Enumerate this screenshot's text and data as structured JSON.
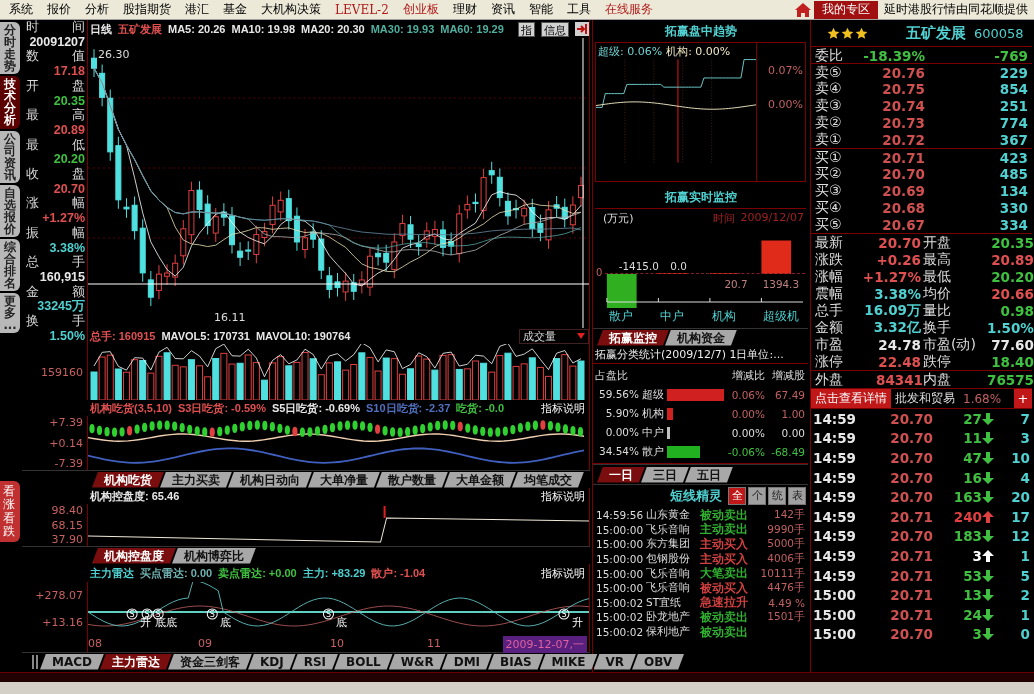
{
  "menu": [
    {
      "label": "系统",
      "highlight": false
    },
    {
      "label": "报价",
      "highlight": false
    },
    {
      "label": "分析",
      "highlight": false
    },
    {
      "label": "股指期货",
      "highlight": false
    },
    {
      "label": "港汇",
      "highlight": false
    },
    {
      "label": "基金",
      "highlight": false
    },
    {
      "label": "大机构决策",
      "highlight": false
    },
    {
      "label": "LEVEL-2",
      "highlight": true
    },
    {
      "label": "创业板",
      "highlight": true
    },
    {
      "label": "理财",
      "highlight": false
    },
    {
      "label": "资讯",
      "highlight": false
    },
    {
      "label": "智能",
      "highlight": false
    },
    {
      "label": "工具",
      "highlight": false
    },
    {
      "label": "在线服务",
      "highlight": true
    }
  ],
  "zone_button": "我的专区",
  "notice": "延时港股行情由同花顺提供",
  "side_tabs": [
    {
      "label": "分时走势",
      "selected": false
    },
    {
      "label": "技术分析",
      "selected": true
    },
    {
      "label": "公司资讯",
      "selected": false
    },
    {
      "label": "自选报价",
      "selected": false
    },
    {
      "label": "综合排名",
      "selected": false
    },
    {
      "label": "更多...",
      "selected": false
    }
  ],
  "side_badge": "看涨看跌",
  "info": [
    {
      "label": "时间",
      "value": "20091207",
      "color": "#e8e8e8"
    },
    {
      "label": "数值",
      "value": "17.18",
      "color": "#e05050"
    },
    {
      "label": "开盘",
      "value": "20.35",
      "color": "#40c040"
    },
    {
      "label": "最高",
      "value": "20.89",
      "color": "#e05050"
    },
    {
      "label": "最低",
      "value": "20.20",
      "color": "#40c040"
    },
    {
      "label": "收盘",
      "value": "20.70",
      "color": "#e05050"
    },
    {
      "label": "涨幅",
      "value": "+1.27%",
      "color": "#e05050"
    },
    {
      "label": "振幅",
      "value": "3.38%",
      "color": "#50d0d0"
    },
    {
      "label": "总手",
      "value": "160,915",
      "color": "#e8e8e8"
    },
    {
      "label": "金额",
      "value": "33245万",
      "color": "#50d0d0"
    },
    {
      "label": "换手",
      "value": "1.50%",
      "color": "#50d0d0"
    }
  ],
  "main_chart": {
    "header": [
      {
        "text": "日线",
        "color": "#e8e8e8"
      },
      {
        "text": "五矿发展",
        "color": "#e05050"
      },
      {
        "text": "MA5: 20.26",
        "color": "#e8e8e8"
      },
      {
        "text": "MA10: 19.98",
        "color": "#e8e8e8"
      },
      {
        "text": "MA20: 20.30",
        "color": "#e8e8e8"
      },
      {
        "text": "MA30: 19.93",
        "color": "#50b0a0"
      },
      {
        "text": "MA60: 19.29",
        "color": "#50b0a0"
      }
    ],
    "buttons": [
      "指",
      "信息"
    ],
    "high_label": "26.30",
    "low_label": "16.11"
  },
  "volume": {
    "header": [
      {
        "text": "总手: 160915",
        "color": "#e05050"
      },
      {
        "text": "MAVOL5: 170731",
        "color": "#e8e8e8"
      },
      {
        "text": "MAVOL10: 190764",
        "color": "#e8e8e8"
      }
    ],
    "dropdown": "成交量",
    "axis": [
      "159160"
    ]
  },
  "indicator_1": {
    "header": [
      {
        "text": "机构吃货(3,5,10)",
        "color": "#e05050"
      },
      {
        "text": "S3日吃货: -0.59%",
        "color": "#e05050"
      },
      {
        "text": "S5日吃货: -0.69%",
        "color": "#e8e8e8"
      },
      {
        "text": "S10日吃货: -2.37",
        "color": "#5070c0"
      },
      {
        "text": "吃货: -0.0",
        "color": "#40c040"
      }
    ],
    "help": "指标说明",
    "axis": [
      "+7.39",
      "+0.14",
      "-7.39"
    ]
  },
  "tabs_1": [
    {
      "label": "机构吃货",
      "selected": true
    },
    {
      "label": "主力买卖",
      "selected": false
    },
    {
      "label": "机构日动向",
      "selected": false
    },
    {
      "label": "大单净量",
      "selected": false
    },
    {
      "label": "散户数量",
      "selected": false
    },
    {
      "label": "大单金额",
      "selected": false
    },
    {
      "label": "均笔成交",
      "selected": false
    }
  ],
  "indicator_2": {
    "header": [
      {
        "text": "机构控盘度: 65.46",
        "color": "#e8e8e8"
      }
    ],
    "help": "指标说明",
    "axis": [
      "98.40",
      "68.15",
      "37.90"
    ]
  },
  "tabs_2": [
    {
      "label": "机构控盘度",
      "selected": true
    },
    {
      "label": "机构博弈比",
      "selected": false
    }
  ],
  "indicator_3": {
    "header": [
      {
        "text": "主力雷达",
        "color": "#50d0d0"
      },
      {
        "text": "买点雷达: 0.00",
        "color": "#70b0b0"
      },
      {
        "text": "卖点雷达: +0.00",
        "color": "#40c040"
      },
      {
        "text": "主力: +83.29",
        "color": "#50d0d0"
      },
      {
        "text": "散户: -1.04",
        "color": "#e05050"
      }
    ],
    "help": "指标说明",
    "axis": [
      "+278.07",
      "+13.16"
    ],
    "markers": [
      {
        "signal": "S",
        "label": "升"
      },
      {
        "signal": "S",
        "label": "底"
      },
      {
        "signal": "S",
        "label": "底"
      },
      {
        "signal": "S",
        "label": "底"
      },
      {
        "signal": "S",
        "label": "底"
      },
      {
        "signal": "S",
        "label": "升"
      }
    ]
  },
  "x_axis": {
    "labels": [
      "08",
      "09",
      "10",
      "11"
    ],
    "cursor_date": "2009-12-07,一"
  },
  "bottom_tabs": [
    {
      "label": "MACD",
      "selected": false
    },
    {
      "label": "主力雷达",
      "selected": true
    },
    {
      "label": "资金三剑客",
      "selected": false
    },
    {
      "label": "KDJ",
      "selected": false
    },
    {
      "label": "RSI",
      "selected": false
    },
    {
      "label": "BOLL",
      "selected": false
    },
    {
      "label": "W&R",
      "selected": false
    },
    {
      "label": "DMI",
      "selected": false
    },
    {
      "label": "BIAS",
      "selected": false
    },
    {
      "label": "MIKE",
      "selected": false
    },
    {
      "label": "VR",
      "selected": false
    },
    {
      "label": "OBV",
      "selected": false
    }
  ],
  "trend": {
    "title": "拓赢盘中趋势",
    "legend": [
      {
        "text": "超级: 0.06%",
        "color": "#70d0d0"
      },
      {
        "text": "机构: 0.00%",
        "color": "#f0e8c0"
      }
    ],
    "axis": [
      "0.07%",
      "0.00%"
    ]
  },
  "monitor": {
    "title": "拓赢实时监控",
    "unit": "(万元)",
    "time_label": "时间",
    "time": "2009/12/07",
    "chart_data": {
      "type": "bar",
      "categories": [
        "散户",
        "中户",
        "机构",
        "超级机"
      ],
      "values": [
        -1415.0,
        0.0,
        20.7,
        1394.3
      ],
      "value_labels": [
        "-1415.0",
        "0.0",
        "20.7",
        "1394.3"
      ]
    },
    "zero_label": "0"
  },
  "panel_tabs": [
    {
      "label": "拓赢监控",
      "selected": true
    },
    {
      "label": "机构资金",
      "selected": false
    }
  ],
  "stats": {
    "title": "拓赢分类统计(2009/12/7) 1日单位:...",
    "columns": [
      "占盘比",
      "增减比",
      "增减股"
    ],
    "rows": [
      {
        "share": "59.56%",
        "group": "超级",
        "color": "#d02020",
        "change": "0.06%",
        "shares": "67.49"
      },
      {
        "share": "5.90%",
        "group": "机构",
        "color": "#d02020",
        "change": "0.00%",
        "shares": "1.00"
      },
      {
        "share": "0.00%",
        "group": "中户",
        "color": "#c0c0c0",
        "change": "0.00%",
        "shares": "0.00"
      },
      {
        "share": "34.54%",
        "group": "散户",
        "color": "#20b020",
        "change": "-0.06%",
        "shares": "-68.49"
      }
    ]
  },
  "day_tabs": [
    {
      "label": "一日",
      "selected": true
    },
    {
      "label": "三日",
      "selected": false
    },
    {
      "label": "五日",
      "selected": false
    }
  ],
  "sprite": {
    "title": "短线精灵",
    "filters": [
      {
        "label": "全",
        "selected": true
      },
      {
        "label": "个",
        "selected": false
      },
      {
        "label": "统",
        "selected": false
      },
      {
        "label": "表",
        "selected": false
      }
    ],
    "rows": [
      {
        "time": "14:59:56",
        "name": "山东黄金",
        "action": "被动卖出",
        "amount": "142手",
        "color": "#30b030"
      },
      {
        "time": "15:00:00",
        "name": "飞乐音响",
        "action": "主动卖出",
        "amount": "9990手",
        "color": "#30b030"
      },
      {
        "time": "15:00:00",
        "name": "东方集团",
        "action": "主动买入",
        "amount": "5000手",
        "color": "#d04040"
      },
      {
        "time": "15:00:00",
        "name": "包钢股份",
        "action": "主动买入",
        "amount": "4006手",
        "color": "#d04040"
      },
      {
        "time": "15:00:00",
        "name": "飞乐音响",
        "action": "大笔卖出",
        "amount": "10111手",
        "color": "#30b030"
      },
      {
        "time": "15:00:00",
        "name": "飞乐音响",
        "action": "被动买入",
        "amount": "4476手",
        "color": "#d04040"
      },
      {
        "time": "15:00:02",
        "name": "ST宜纸",
        "action": "急速拉升",
        "amount": "4.49 %",
        "color": "#d04040"
      },
      {
        "time": "15:00:02",
        "name": "卧龙地产",
        "action": "被动卖出",
        "amount": "1501手",
        "color": "#30b030"
      },
      {
        "time": "15:00:02",
        "name": "保利地产",
        "action": "被动卖出",
        "color": "#30b030"
      }
    ]
  },
  "rating": {
    "stars": 3
  },
  "stock": {
    "name": "五矿发展",
    "code": "600058"
  },
  "ratio": {
    "label": "委比",
    "value": "-18.39%",
    "volume": "-769"
  },
  "asks": [
    {
      "label": "卖⑤",
      "price": "20.76",
      "volume": "229"
    },
    {
      "label": "卖④",
      "price": "20.75",
      "volume": "854"
    },
    {
      "label": "卖③",
      "price": "20.74",
      "volume": "251"
    },
    {
      "label": "卖②",
      "price": "20.73",
      "volume": "774"
    },
    {
      "label": "卖①",
      "price": "20.72",
      "volume": "367"
    }
  ],
  "bids": [
    {
      "label": "买①",
      "price": "20.71",
      "volume": "423"
    },
    {
      "label": "买②",
      "price": "20.70",
      "volume": "485"
    },
    {
      "label": "买③",
      "price": "20.69",
      "volume": "134"
    },
    {
      "label": "买④",
      "price": "20.68",
      "volume": "330"
    },
    {
      "label": "买⑤",
      "price": "20.67",
      "volume": "334"
    }
  ],
  "quote_stats": [
    {
      "label": "最新",
      "value": "20.70",
      "color": "#e05050"
    },
    {
      "label": "开盘",
      "value": "20.35",
      "color": "#40c040"
    },
    {
      "label": "涨跌",
      "value": "+0.26",
      "color": "#e05050"
    },
    {
      "label": "最高",
      "value": "20.89",
      "color": "#e05050"
    },
    {
      "label": "涨幅",
      "value": "+1.27%",
      "color": "#e05050"
    },
    {
      "label": "最低",
      "value": "20.20",
      "color": "#40c040"
    },
    {
      "label": "震幅",
      "value": "3.38%",
      "color": "#50d0d0"
    },
    {
      "label": "均价",
      "value": "20.66",
      "color": "#e05050"
    },
    {
      "label": "总手",
      "value": "16.09万",
      "color": "#50d0d0"
    },
    {
      "label": "量比",
      "value": "0.98",
      "color": "#40c040"
    },
    {
      "label": "金额",
      "value": "3.32亿",
      "color": "#50d0d0"
    },
    {
      "label": "换手",
      "value": "1.50%",
      "color": "#50d0d0"
    },
    {
      "label": "市盈",
      "value": "24.78",
      "color": "#e8e8e8"
    },
    {
      "label": "市盈(动)",
      "value": "77.60",
      "color": "#e8e8e8"
    },
    {
      "label": "涨停",
      "value": "22.48",
      "color": "#e05050"
    },
    {
      "label": "跌停",
      "value": "18.40",
      "color": "#40c040"
    }
  ],
  "flow": [
    {
      "label": "外盘",
      "value": "84341",
      "color": "#e05050"
    },
    {
      "label": "内盘",
      "value": "76575",
      "color": "#40c040"
    }
  ],
  "detail_bar": {
    "button": "点击查看详情",
    "industry": "批发和贸易",
    "change": "1.68%",
    "plus": "+"
  },
  "ticks": [
    {
      "time": "14:59",
      "price": "20.70",
      "volume": "27",
      "kind": "down",
      "color": "#40c040",
      "column_5": "7"
    },
    {
      "time": "14:59",
      "price": "20.70",
      "volume": "11",
      "kind": "down",
      "color": "#40c040",
      "column_5": "3"
    },
    {
      "time": "14:59",
      "price": "20.70",
      "volume": "47",
      "kind": "down",
      "color": "#40c040",
      "column_5": "10"
    },
    {
      "time": "14:59",
      "price": "20.70",
      "volume": "16",
      "kind": "down",
      "color": "#40c040",
      "column_5": "4"
    },
    {
      "time": "14:59",
      "price": "20.70",
      "volume": "163",
      "kind": "down",
      "color": "#40c040",
      "column_5": "20"
    },
    {
      "time": "14:59",
      "price": "20.71",
      "volume": "240",
      "kind": "up",
      "color": "#e04040",
      "column_5": "17"
    },
    {
      "time": "14:59",
      "price": "20.70",
      "volume": "183",
      "kind": "down",
      "color": "#40c040",
      "column_5": "12"
    },
    {
      "time": "14:59",
      "price": "20.71",
      "volume": "3",
      "kind": "up",
      "color": "#ffffff",
      "column_5": "1"
    },
    {
      "time": "14:59",
      "price": "20.71",
      "volume": "53",
      "kind": "down",
      "color": "#40c040",
      "column_5": "5"
    },
    {
      "time": "15:00",
      "price": "20.71",
      "volume": "13",
      "kind": "down",
      "color": "#40c040",
      "column_5": "2"
    },
    {
      "time": "15:00",
      "price": "20.71",
      "volume": "24",
      "kind": "down",
      "color": "#40c040",
      "column_5": "1"
    },
    {
      "time": "15:00",
      "price": "20.70",
      "volume": "3",
      "kind": "down",
      "color": "#40c040",
      "column_5": "0"
    }
  ]
}
